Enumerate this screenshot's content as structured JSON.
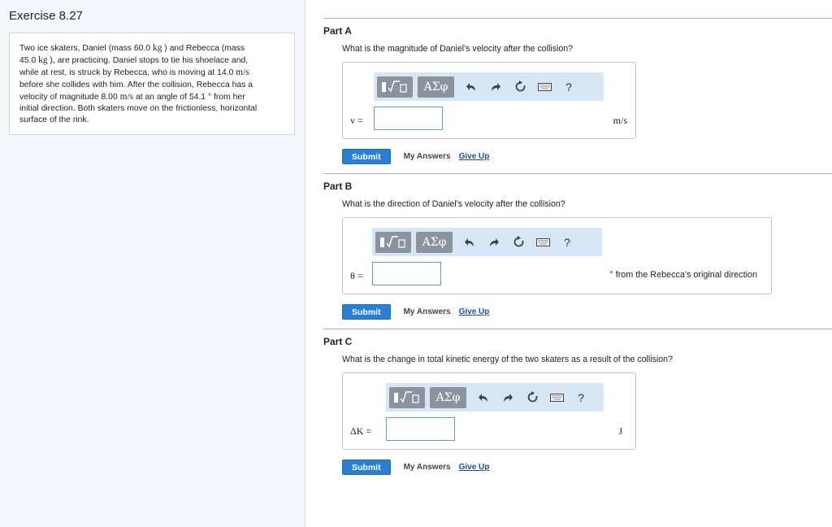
{
  "exercise": {
    "title": "Exercise 8.27"
  },
  "problem": {
    "lines": [
      [
        "Two ice skaters, Daniel (mass 60.0 ",
        "kg",
        " ) and Rebecca (mass"
      ],
      [
        "45.0 ",
        "kg",
        " ), are practicing. Daniel stops to tie his shoelace and,"
      ],
      [
        "while at rest, is struck by Rebecca, who is moving at 14.0 ",
        "m/s",
        ""
      ],
      [
        "before she collides with him. After the collision, Rebecca has a",
        "",
        ""
      ],
      [
        "velocity of magnitude 8.00 ",
        "m/s",
        " at an angle of 54.1 ° from her"
      ],
      [
        "initial direction. Both skaters move on the frictionless, horizontal",
        "",
        ""
      ],
      [
        "surface of the rink.",
        "",
        ""
      ]
    ]
  },
  "toolbar": {
    "template_icon": "sqrt-template-icon",
    "symbols_label": "ΑΣφ",
    "undo_icon": "undo-icon",
    "redo_icon": "redo-icon",
    "reset_icon": "reset-icon",
    "keyboard_icon": "keyboard-icon",
    "help_label": "?"
  },
  "parts": {
    "a": {
      "title": "Part A",
      "question": "What is the magnitude of Daniel's velocity after the collision?",
      "var_label": "v =",
      "input_value": "",
      "unit": "m/s",
      "submit": "Submit",
      "my_answers": "My Answers",
      "give_up": "Give Up"
    },
    "b": {
      "title": "Part B",
      "question": "What is the direction of Daniel's velocity after the collision?",
      "var_label": "θ =",
      "input_value": "",
      "unit": "° from the Rebecca's original direction",
      "submit": "Submit",
      "my_answers": "My Answers",
      "give_up": "Give Up"
    },
    "c": {
      "title": "Part C",
      "question": "What is the change in total kinetic energy of the two skaters as a result of the collision?",
      "var_label": "ΔK =",
      "input_value": "",
      "unit": "J",
      "submit": "Submit",
      "my_answers": "My Answers",
      "give_up": "Give Up"
    }
  },
  "colors": {
    "submit_bg": "#2b7fd3",
    "toolbar_bg": "#d6e6f5",
    "input_border": "#5b9bd5",
    "link": "#1a4f9c"
  }
}
